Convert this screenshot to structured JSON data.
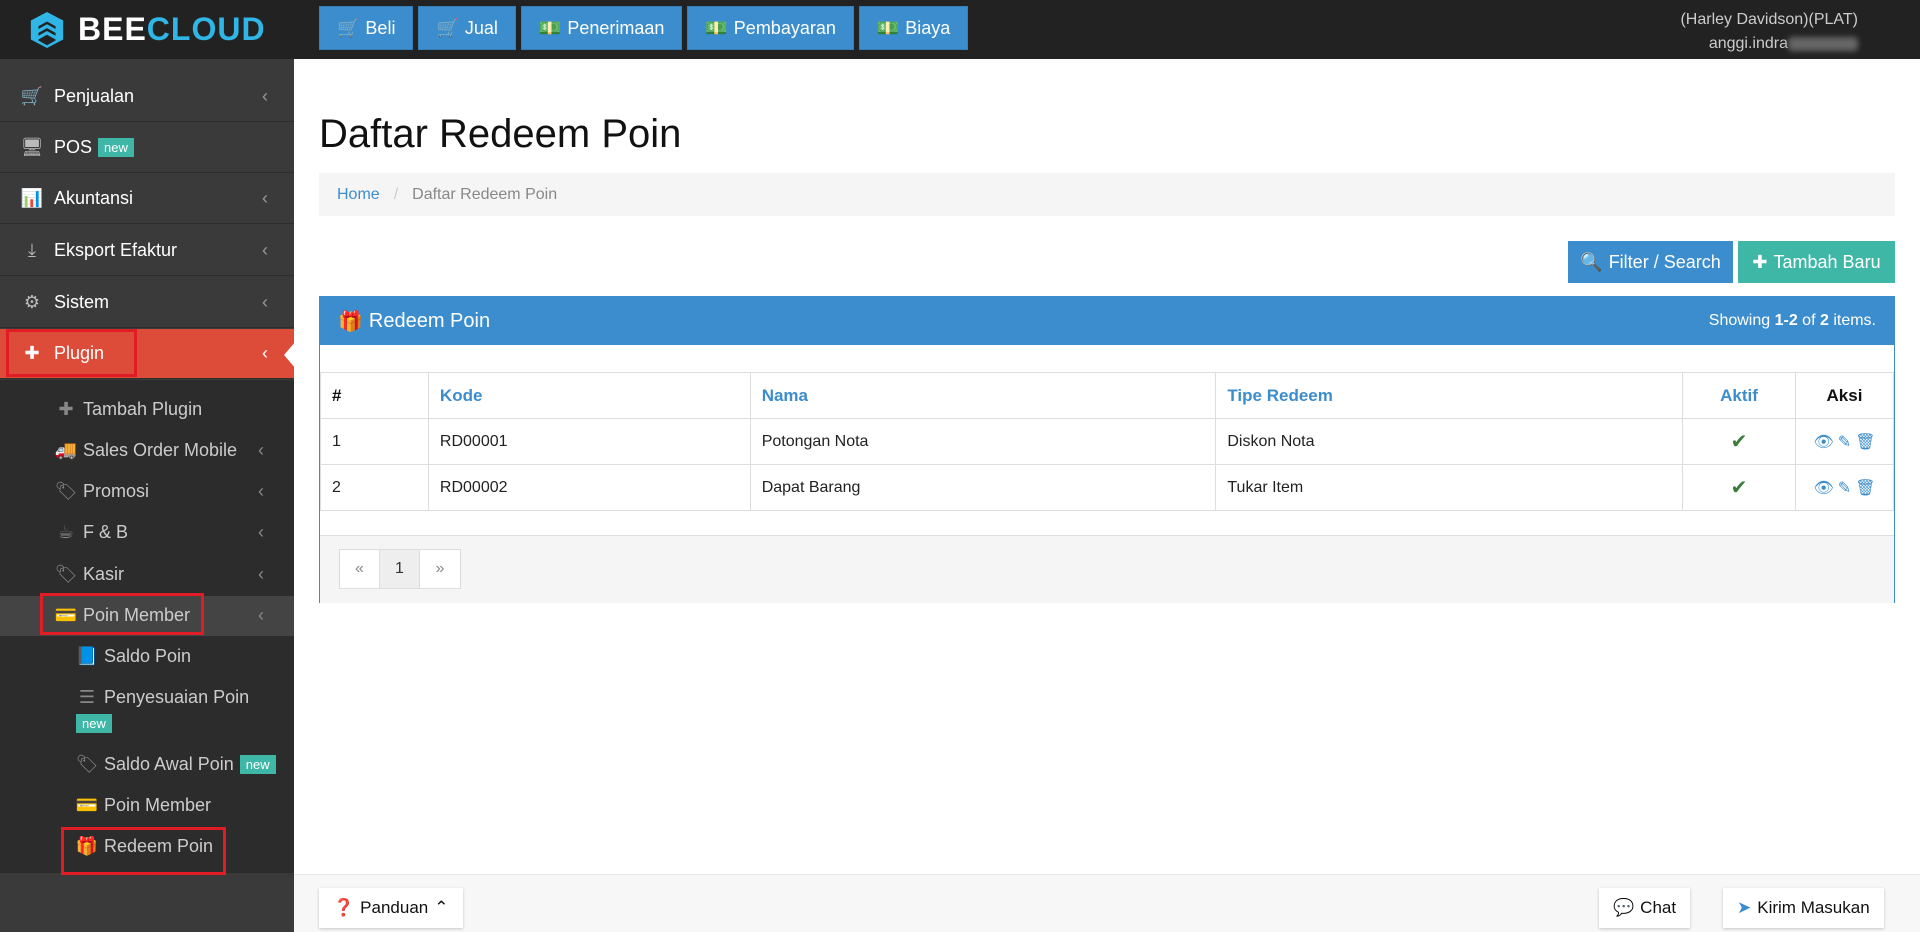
{
  "brand": {
    "part1": "BEE",
    "part2": "CLOUD"
  },
  "quick_actions": [
    {
      "label": "Beli",
      "icon": "cart-icon"
    },
    {
      "label": "Jual",
      "icon": "cart-icon"
    },
    {
      "label": "Penerimaan",
      "icon": "money-icon"
    },
    {
      "label": "Pembayaran",
      "icon": "money-icon"
    },
    {
      "label": "Biaya",
      "icon": "money-icon"
    }
  ],
  "user": {
    "company": "(Harley Davidson)(PLAT)",
    "name": "anggi.indra"
  },
  "sidebar": {
    "items": [
      {
        "label": "Penjualan",
        "icon": "cart-icon"
      },
      {
        "label": "POS",
        "icon": "monitor-icon",
        "badge": "new"
      },
      {
        "label": "Akuntansi",
        "icon": "bar-chart-icon"
      },
      {
        "label": "Eksport Efaktur",
        "icon": "export-icon"
      },
      {
        "label": "Sistem",
        "icon": "gears-icon"
      },
      {
        "label": "Plugin",
        "icon": "puzzle-icon"
      }
    ],
    "plugin_sub": [
      {
        "label": "Tambah Plugin",
        "icon": "plus-icon"
      },
      {
        "label": "Sales Order Mobile",
        "icon": "truck-icon"
      },
      {
        "label": "Promosi",
        "icon": "tags-icon"
      },
      {
        "label": "F & B",
        "icon": "coffee-icon"
      },
      {
        "label": "Kasir",
        "icon": "tags-icon"
      },
      {
        "label": "Poin Member",
        "icon": "card-icon"
      }
    ],
    "poin_sub": [
      {
        "label": "Saldo Poin",
        "icon": "book-icon"
      },
      {
        "label": "Penyesuaian Poin",
        "icon": "sliders-icon",
        "badge": "new"
      },
      {
        "label": "Saldo Awal Poin",
        "icon": "tag-icon",
        "badge": "new"
      },
      {
        "label": "Poin Member",
        "icon": "card-icon"
      },
      {
        "label": "Redeem Poin",
        "icon": "gift-icon"
      }
    ]
  },
  "page": {
    "title": "Daftar Redeem Poin",
    "breadcrumb": {
      "home": "Home",
      "current": "Daftar Redeem Poin"
    },
    "filter_label": "Filter / Search",
    "add_label": "Tambah Baru"
  },
  "panel": {
    "title": "Redeem Poin",
    "summary_prefix": "Showing ",
    "summary_range": "1-2",
    "summary_of": " of ",
    "summary_total": "2",
    "summary_suffix": " items."
  },
  "table": {
    "headers": {
      "no": "#",
      "kode": "Kode",
      "nama": "Nama",
      "tipe": "Tipe Redeem",
      "aktif": "Aktif",
      "aksi": "Aksi"
    },
    "rows": [
      {
        "no": "1",
        "kode": "RD00001",
        "nama": "Potongan Nota",
        "tipe": "Diskon Nota",
        "aktif": true
      },
      {
        "no": "2",
        "kode": "RD00002",
        "nama": "Dapat Barang",
        "tipe": "Tukar Item",
        "aktif": true
      }
    ]
  },
  "pagination": {
    "prev": "«",
    "current": "1",
    "next": "»"
  },
  "footer": {
    "guide": "Panduan",
    "chat": "Chat",
    "feedback": "Kirim Masukan"
  },
  "colors": {
    "primary": "#3c8dcd",
    "success": "#3fb7a6",
    "active": "#dd4b39",
    "sidebar": "#3a3a3a",
    "highlight_box": "#e01c24"
  }
}
